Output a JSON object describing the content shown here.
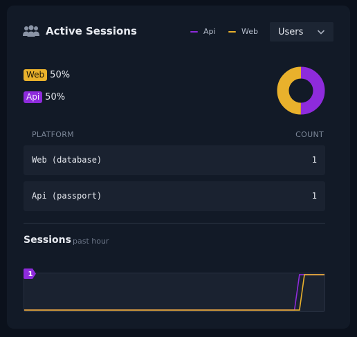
{
  "header": {
    "title": "Active Sessions",
    "icon": "users-icon",
    "legend": [
      {
        "label": "Api",
        "color": "#8e2bdc"
      },
      {
        "label": "Web",
        "color": "#e9b12c"
      }
    ],
    "select": {
      "value": "Users",
      "icon": "chevron-down-icon"
    }
  },
  "stats": {
    "web": {
      "badge": "Web",
      "percent": "50%",
      "color": "#e9b12c"
    },
    "api": {
      "badge": "Api",
      "percent": "50%",
      "color": "#8e2bdc"
    }
  },
  "table": {
    "headers": {
      "platform": "PLATFORM",
      "count": "COUNT"
    },
    "rows": [
      {
        "platform": "Web (database)",
        "count": "1"
      },
      {
        "platform": "Api (passport)",
        "count": "1"
      }
    ]
  },
  "sessions": {
    "title": "Sessions",
    "subtitle": "past hour",
    "y_max_label": "1"
  },
  "chart_data": [
    {
      "type": "pie",
      "categories": [
        "Api",
        "Web"
      ],
      "values": [
        50,
        50
      ],
      "colors": [
        "#8e2bdc",
        "#e9b12c"
      ]
    },
    {
      "type": "line",
      "ylim": [
        0,
        1
      ],
      "x": [
        0,
        1,
        2,
        3,
        4,
        5,
        6,
        7,
        8,
        9,
        10,
        11,
        12,
        13,
        14,
        15,
        16,
        17,
        18,
        19,
        20,
        21,
        22,
        23,
        24,
        25,
        26,
        27,
        28,
        29,
        30,
        31,
        32,
        33,
        34,
        35,
        36,
        37,
        38,
        39,
        40,
        41,
        42,
        43,
        44,
        45,
        46,
        47,
        48,
        49,
        50,
        51,
        52,
        53,
        54,
        55,
        56,
        57,
        58,
        59,
        60
      ],
      "series": [
        {
          "name": "Api",
          "color": "#8e2bdc",
          "values": [
            0,
            0,
            0,
            0,
            0,
            0,
            0,
            0,
            0,
            0,
            0,
            0,
            0,
            0,
            0,
            0,
            0,
            0,
            0,
            0,
            0,
            0,
            0,
            0,
            0,
            0,
            0,
            0,
            0,
            0,
            0,
            0,
            0,
            0,
            0,
            0,
            0,
            0,
            0,
            0,
            0,
            0,
            0,
            0,
            0,
            0,
            0,
            0,
            0,
            0,
            0,
            0,
            0,
            0,
            0,
            1,
            1,
            1,
            1,
            1,
            1
          ]
        },
        {
          "name": "Web",
          "color": "#e9b12c",
          "values": [
            0,
            0,
            0,
            0,
            0,
            0,
            0,
            0,
            0,
            0,
            0,
            0,
            0,
            0,
            0,
            0,
            0,
            0,
            0,
            0,
            0,
            0,
            0,
            0,
            0,
            0,
            0,
            0,
            0,
            0,
            0,
            0,
            0,
            0,
            0,
            0,
            0,
            0,
            0,
            0,
            0,
            0,
            0,
            0,
            0,
            0,
            0,
            0,
            0,
            0,
            0,
            0,
            0,
            0,
            0,
            0,
            1,
            1,
            1,
            1,
            1
          ]
        }
      ]
    }
  ]
}
